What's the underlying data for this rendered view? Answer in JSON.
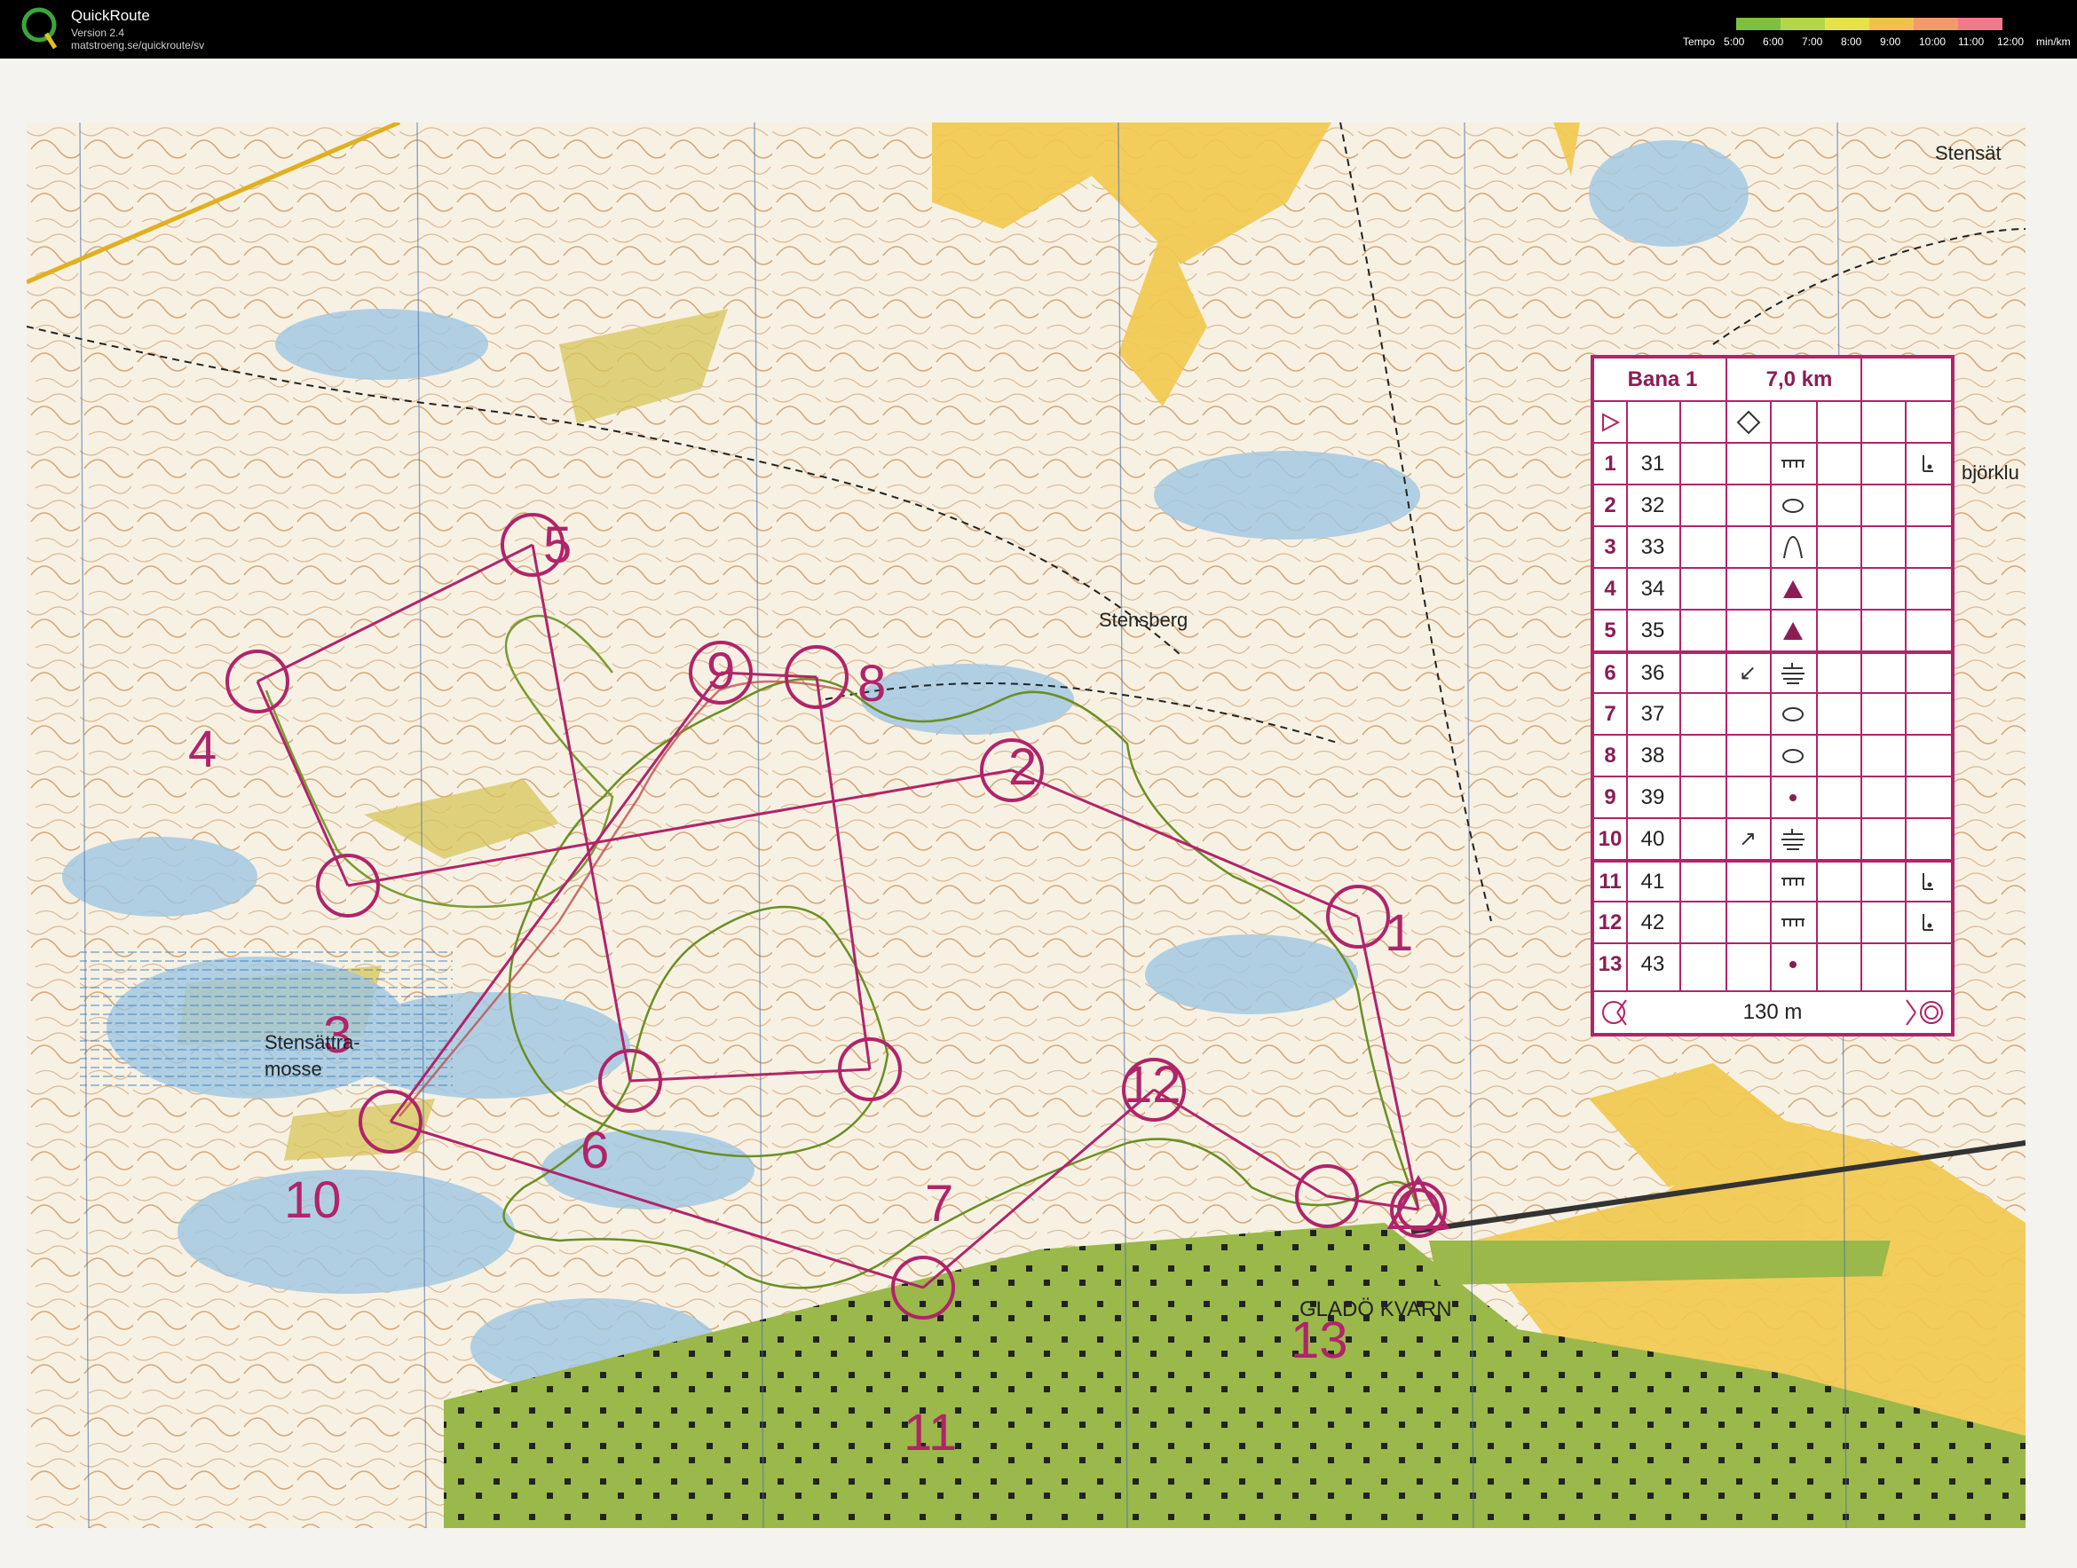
{
  "app": {
    "title": "QuickRoute",
    "version": "Version 2.4",
    "url": "matstroeng.se/quickroute/sv"
  },
  "tempo": {
    "label": "Tempo",
    "ticks": [
      "5:00",
      "6:00",
      "7:00",
      "8:00",
      "9:00",
      "10:00",
      "11:00",
      "12:00"
    ],
    "unit": "min/km",
    "colors": [
      "#7fbf3f",
      "#b4d64a",
      "#e6e34a",
      "#f2c14a",
      "#f29a6a",
      "#f07a8a"
    ]
  },
  "map": {
    "place_labels": [
      "Stensberg",
      "Stensättra-",
      "mosse",
      "GLADÖ KVARN",
      "Stensät",
      "björklu"
    ],
    "course_color": "#b0246a",
    "route_color": "#5c8a2e"
  },
  "controls": [
    {
      "number": "1"
    },
    {
      "number": "2"
    },
    {
      "number": "3"
    },
    {
      "number": "4"
    },
    {
      "number": "5"
    },
    {
      "number": "6"
    },
    {
      "number": "7"
    },
    {
      "number": "8"
    },
    {
      "number": "9"
    },
    {
      "number": "10"
    },
    {
      "number": "11"
    },
    {
      "number": "12"
    },
    {
      "number": "13"
    }
  ],
  "legend": {
    "course_name": "Bana 1",
    "length": "7,0 km",
    "rows": [
      {
        "num": "1",
        "code": "31",
        "dir": "",
        "symbol": "ditch",
        "extra": "corner"
      },
      {
        "num": "2",
        "code": "32",
        "dir": "",
        "symbol": "knoll-oval",
        "extra": ""
      },
      {
        "num": "3",
        "code": "33",
        "dir": "",
        "symbol": "spur",
        "extra": ""
      },
      {
        "num": "4",
        "code": "34",
        "dir": "",
        "symbol": "triangle",
        "extra": ""
      },
      {
        "num": "5",
        "code": "35",
        "dir": "",
        "symbol": "triangle",
        "extra": ""
      },
      {
        "num": "6",
        "code": "36",
        "dir": "↙",
        "symbol": "marsh",
        "extra": ""
      },
      {
        "num": "7",
        "code": "37",
        "dir": "",
        "symbol": "knoll-oval",
        "extra": ""
      },
      {
        "num": "8",
        "code": "38",
        "dir": "",
        "symbol": "knoll-oval",
        "extra": ""
      },
      {
        "num": "9",
        "code": "39",
        "dir": "",
        "symbol": "dot",
        "extra": ""
      },
      {
        "num": "10",
        "code": "40",
        "dir": "↗",
        "symbol": "marsh",
        "extra": ""
      },
      {
        "num": "11",
        "code": "41",
        "dir": "",
        "symbol": "ditch",
        "extra": "corner"
      },
      {
        "num": "12",
        "code": "42",
        "dir": "",
        "symbol": "ditch",
        "extra": "corner"
      },
      {
        "num": "13",
        "code": "43",
        "dir": "",
        "symbol": "dot",
        "extra": ""
      }
    ],
    "finish_distance": "130 m"
  }
}
